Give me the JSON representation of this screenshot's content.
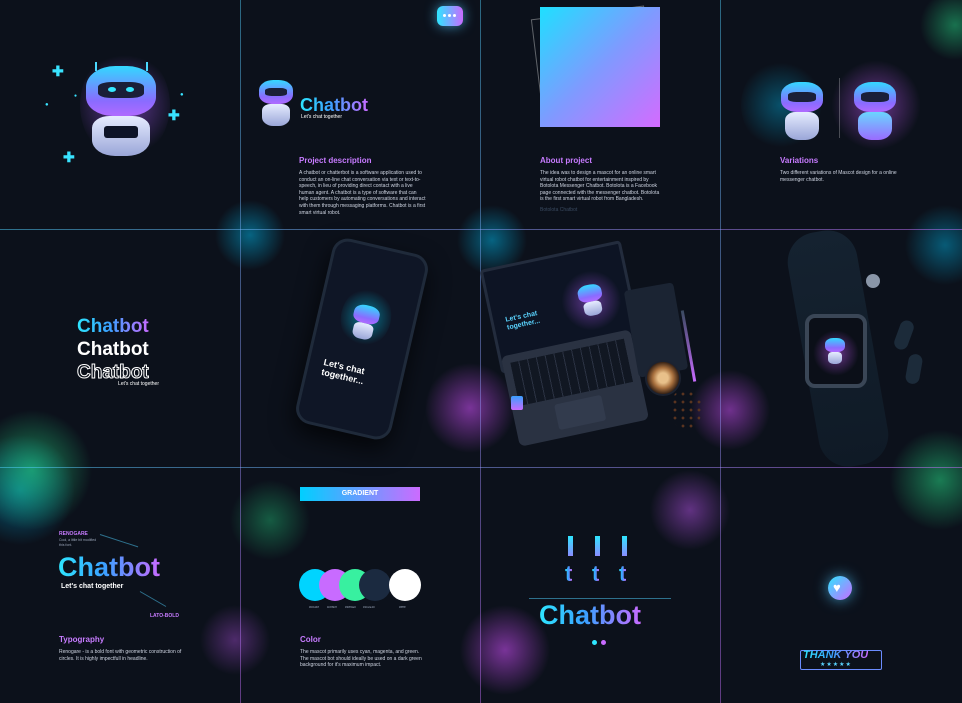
{
  "brand": {
    "name": "Chatbot",
    "tagline": "Let's chat together",
    "outline_name": "Chatbot"
  },
  "project": {
    "heading": "Project description",
    "text": "A chatbot or chatterbot is a software application used to conduct an on-line chat conversation via text or text-to-speech, in lieu of providing direct contact with a live human agent. A chatbot is a type of software that can help customers by automating conversations and interact with them through messaging platforms. Chatbot is a first smart virtual robot."
  },
  "about": {
    "heading": "About project",
    "text": "The idea was to design a mascot for an online smart virtual robot chatbot for entertainment inspired by Botolota Messenger Chatbot. Botolota is a Facebook page connected with the messenger chatbot. Botolota is the first smart virtual robot from Bangladesh.",
    "muted_link": "Botolota Chatbot"
  },
  "variations": {
    "heading": "Variations",
    "text": "Two different variations of Mascot design for a online messenger chatbot."
  },
  "mockups": {
    "phone_text": "Let's chat together...",
    "laptop_text": "Let's chat together..."
  },
  "typography": {
    "heading": "Typography",
    "font_primary": "RENOGARE",
    "font_primary_note": "Cool, a little bit modified this font.",
    "font_secondary": "LATO-BOLD",
    "text": "Renogare - is a bold font with geometric construction of circles. It is highly impectfull in headline."
  },
  "gradient": {
    "label": "GRADIENT",
    "from": "#00cfff",
    "to": "#cc6bff"
  },
  "colors": {
    "heading": "Color",
    "text": "The mascot primarily uses cyan, magenta, and green. The mascot bot should ideally be used on a dark green background for it's maximum impact.",
    "swatches": [
      {
        "hex": "#00d4ff",
        "label": "#00d4ff"
      },
      {
        "hex": "#c86bff",
        "label": "#c86bff"
      },
      {
        "hex": "#38f0a0",
        "label": "#38f0a0"
      },
      {
        "hex": "#1b2a40",
        "label": "#1b2a40"
      },
      {
        "hex": "#ffffff",
        "label": "#ffffff"
      }
    ]
  },
  "logo_construction": {
    "letters": [
      "t",
      "t",
      "t"
    ],
    "word": "Chatbot"
  },
  "thanks": {
    "text": "THANK YOU",
    "stars": "★★★★★"
  },
  "icons": {
    "chat_bubble": "chat-bubble-icon",
    "heart": "heart-icon"
  }
}
